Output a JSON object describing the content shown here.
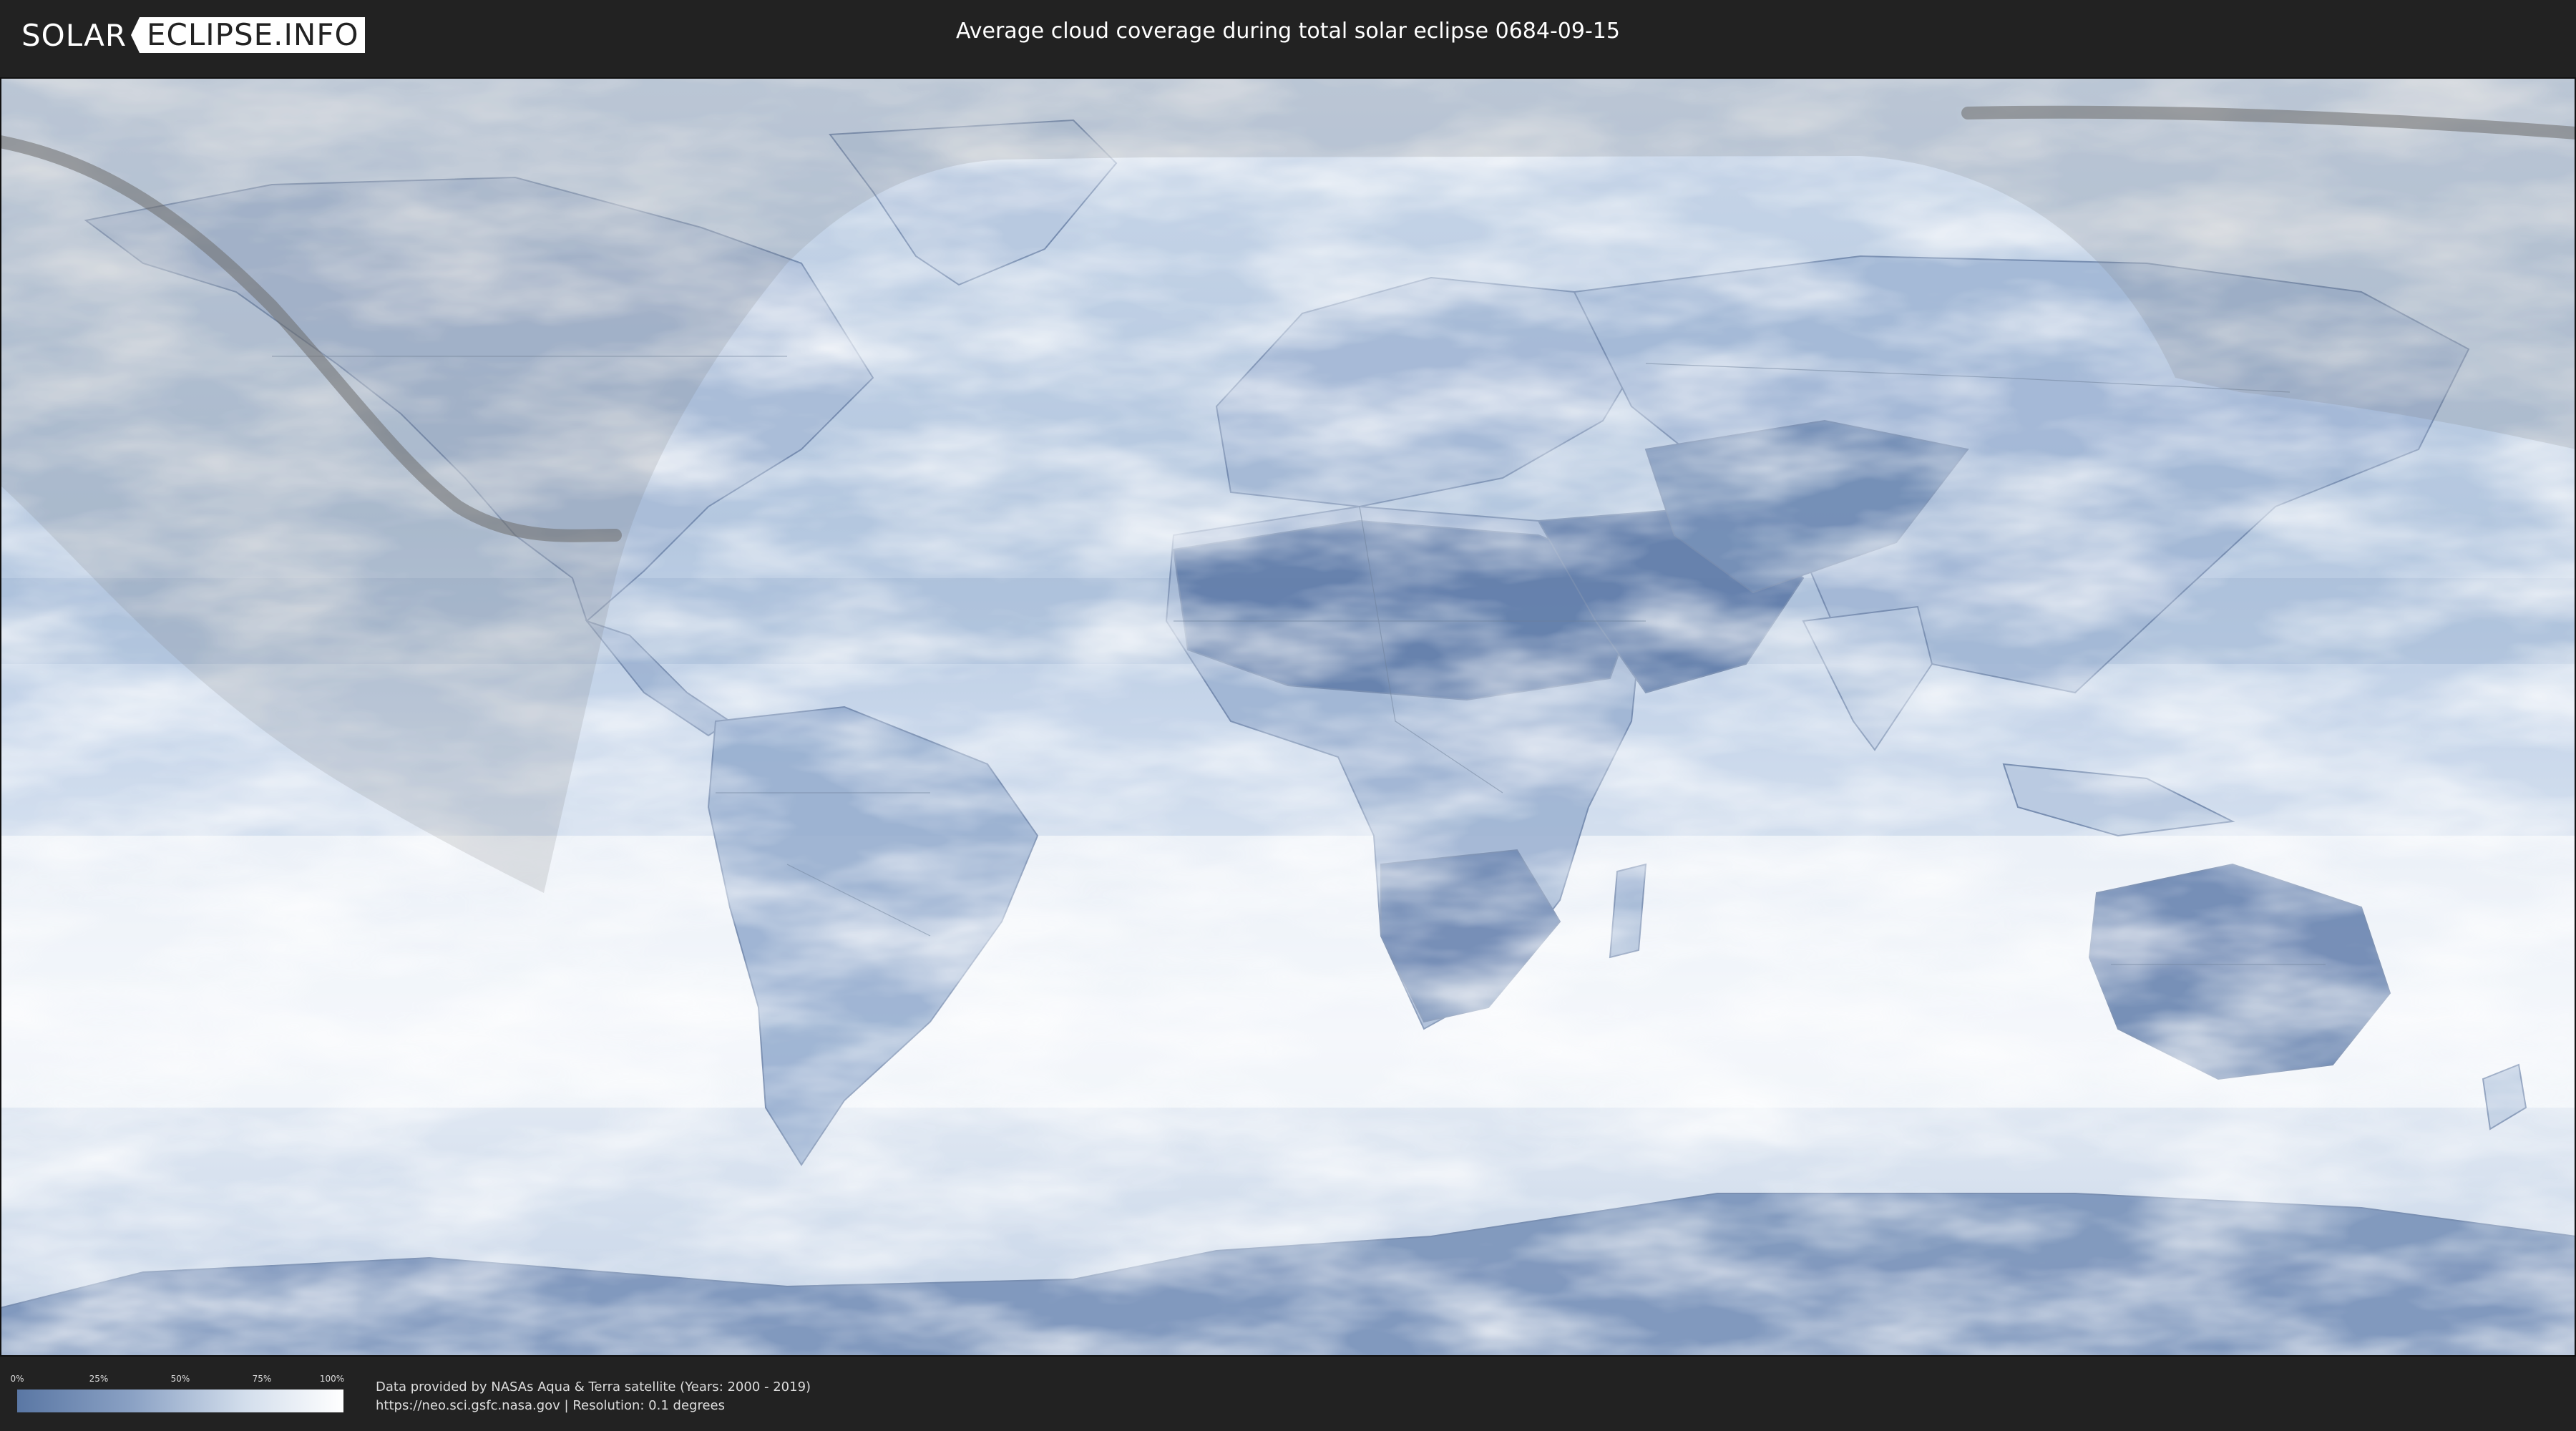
{
  "header": {
    "logo_left": "SOLAR",
    "logo_right": "ECLIPSE.INFO",
    "title": "Average cloud coverage during total solar eclipse 0684-09-15"
  },
  "map": {
    "projection": "equirectangular",
    "ocean_color": "#d6e2ef",
    "land_clear_color": "#5f7ba8",
    "cloud_color": "#ffffff",
    "eclipse_path_color": "#6b6b6b",
    "penumbra_shade_color": "#9a9a9a"
  },
  "legend": {
    "ticks": [
      "0%",
      "25%",
      "50%",
      "75%",
      "100%"
    ],
    "gradient": [
      "#5a77a4",
      "#8aa1c4",
      "#d3deec",
      "#ffffff"
    ]
  },
  "credits": {
    "line1": "Data provided by NASAs Aqua & Terra satellite (Years: 2000 - 2019)",
    "line2": "https://neo.sci.gsfc.nasa.gov | Resolution: 0.1 degrees"
  }
}
